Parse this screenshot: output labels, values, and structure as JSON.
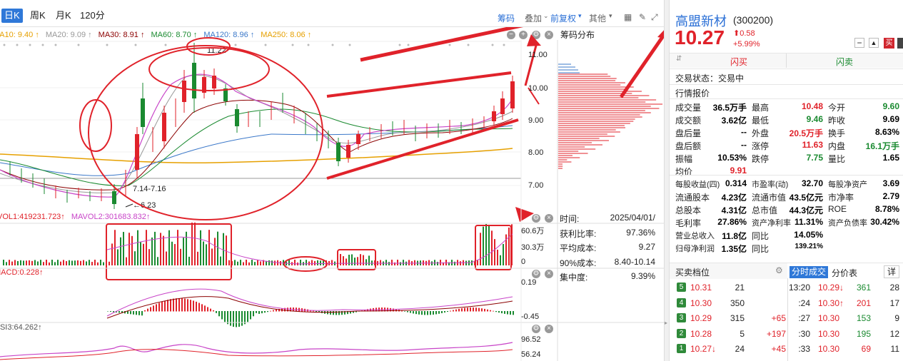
{
  "toolbar": {
    "tabs": [
      "日K",
      "周K",
      "月K",
      "120分"
    ],
    "active_tab": "日K",
    "chouma": "筹码",
    "overlay": "叠加",
    "fq": "前复权",
    "other": "其他"
  },
  "ma_legend": [
    {
      "label": "MA10: 9.40 ↑",
      "color": "#e6a000"
    },
    {
      "label": "MA20: 9.09 ↑",
      "color": "#999999"
    },
    {
      "label": "MA30: 8.91 ↑",
      "color": "#8b0000"
    },
    {
      "label": "MA60: 8.70 ↑",
      "color": "#1a8a30"
    },
    {
      "label": "MA120: 8.96 ↑",
      "color": "#3b78c9"
    },
    {
      "label": "MA250: 8.06 ↑",
      "color": "#e6a000"
    }
  ],
  "price_axis": [
    "11.00",
    "10.00",
    "9.00",
    "8.00",
    "7.00"
  ],
  "annotations": {
    "high": "11.22",
    "range": "7.14-7.16",
    "low": "6.23"
  },
  "vol": {
    "legend1": "VOL1:419231.723↑",
    "legend2": "MAVOL2:301683.832↑",
    "axis": [
      "60.6万",
      "30.3万",
      "0"
    ]
  },
  "macd": {
    "legend": "MACD:0.228↑",
    "axis": [
      "0.19",
      "-0.45"
    ]
  },
  "rsi": {
    "legend": "RSI3:64.262↑",
    "axis": [
      "96.52",
      "56.24"
    ]
  },
  "chip": {
    "title": "筹码分布",
    "rows": [
      {
        "k": "时间:",
        "v": "2025/04/01/"
      },
      {
        "k": "获利比率:",
        "v": "97.36%"
      },
      {
        "k": "平均成本:",
        "v": "9.27"
      },
      {
        "k": "90%成本:",
        "v": "8.40-10.14"
      },
      {
        "k": "集中度:",
        "v": "9.39%"
      }
    ]
  },
  "stock": {
    "name": "高盟新材",
    "code": "(300200)",
    "price": "10.27",
    "change": "0.58",
    "pct": "+5.99%",
    "buy_flash": "闪买",
    "sell_flash": "闪卖",
    "buy_btn": "买",
    "status": "交易状态：交易中",
    "quote_title": "行情报价",
    "quote": [
      [
        {
          "k": "成交量",
          "v": "36.5万手",
          "c": "#000"
        },
        {
          "k": "最高",
          "v": "10.48",
          "c": "#e0222a"
        },
        {
          "k": "今开",
          "v": "9.60",
          "c": "#1a8a30"
        }
      ],
      [
        {
          "k": "成交额",
          "v": "3.62亿",
          "c": "#000"
        },
        {
          "k": "最低",
          "v": "9.46",
          "c": "#1a8a30"
        },
        {
          "k": "昨收",
          "v": "9.69",
          "c": "#000"
        }
      ],
      [
        {
          "k": "盘后量",
          "v": "--",
          "c": "#000"
        },
        {
          "k": "外盘",
          "v": "20.5万手",
          "c": "#e0222a"
        },
        {
          "k": "换手",
          "v": "8.63%",
          "c": "#000"
        }
      ],
      [
        {
          "k": "盘后额",
          "v": "--",
          "c": "#000"
        },
        {
          "k": "涨停",
          "v": "11.63",
          "c": "#e0222a"
        },
        {
          "k": "内盘",
          "v": "16.1万手",
          "c": "#1a8a30"
        }
      ],
      [
        {
          "k": "振幅",
          "v": "10.53%",
          "c": "#000"
        },
        {
          "k": "跌停",
          "v": "7.75",
          "c": "#1a8a30"
        },
        {
          "k": "量比",
          "v": "1.65",
          "c": "#000"
        }
      ],
      [
        {
          "k": "均价",
          "v": "9.91",
          "c": "#e0222a"
        }
      ]
    ],
    "fund": [
      [
        {
          "k": "每股收益(四)",
          "v": "0.314"
        },
        {
          "k": "市盈率(动)",
          "v": "32.70"
        },
        {
          "k": "每股净资产",
          "v": "3.69"
        }
      ],
      [
        {
          "k": "流通股本",
          "v": "4.23亿"
        },
        {
          "k": "流通市值",
          "v": "43.5亿元"
        },
        {
          "k": "市净率",
          "v": "2.79"
        }
      ],
      [
        {
          "k": "总股本",
          "v": "4.31亿"
        },
        {
          "k": "总市值",
          "v": "44.3亿元"
        },
        {
          "k": "ROE",
          "v": "8.78%"
        }
      ],
      [
        {
          "k": "毛利率",
          "v": "27.86%"
        },
        {
          "k": "资产净利率",
          "v": "11.31%"
        },
        {
          "k": "资产负债率",
          "v": "30.42%"
        }
      ],
      [
        {
          "k": "营业总收入",
          "v": "11.8亿"
        },
        {
          "k": "同比",
          "v": "14.05%"
        }
      ],
      [
        {
          "k": "归母净利润",
          "v": "1.35亿"
        },
        {
          "k": "同比",
          "v": "139.21%"
        }
      ]
    ],
    "book_title": "买卖档位",
    "book": [
      {
        "lvl": "5",
        "price": "10.31",
        "vol": "21",
        "chg": ""
      },
      {
        "lvl": "4",
        "price": "10.30",
        "vol": "350",
        "chg": ""
      },
      {
        "lvl": "3",
        "price": "10.29",
        "vol": "315",
        "chg": "+65"
      },
      {
        "lvl": "2",
        "price": "10.28",
        "vol": "5",
        "chg": "+197"
      },
      {
        "lvl": "1",
        "price": "10.27↓",
        "vol": "24",
        "chg": "+45"
      }
    ],
    "tick_tabs": [
      "分时成交",
      "分价表",
      "详"
    ],
    "ticks": [
      {
        "t": "13:20",
        "p": "10.29↓",
        "v": "361",
        "n": "28",
        "pc": "#e0222a",
        "vc": "#1a8a30"
      },
      {
        "t": ":24",
        "p": "10.30↑",
        "v": "201",
        "n": "17",
        "pc": "#e0222a",
        "vc": "#e0222a"
      },
      {
        "t": ":27",
        "p": "10.30",
        "v": "153",
        "n": "9",
        "pc": "#e0222a",
        "vc": "#1a8a30"
      },
      {
        "t": ":30",
        "p": "10.30",
        "v": "195",
        "n": "12",
        "pc": "#e0222a",
        "vc": "#1a8a30"
      },
      {
        "t": ":33",
        "p": "10.30",
        "v": "69",
        "n": "11",
        "pc": "#e0222a",
        "vc": "#e0222a"
      }
    ]
  }
}
